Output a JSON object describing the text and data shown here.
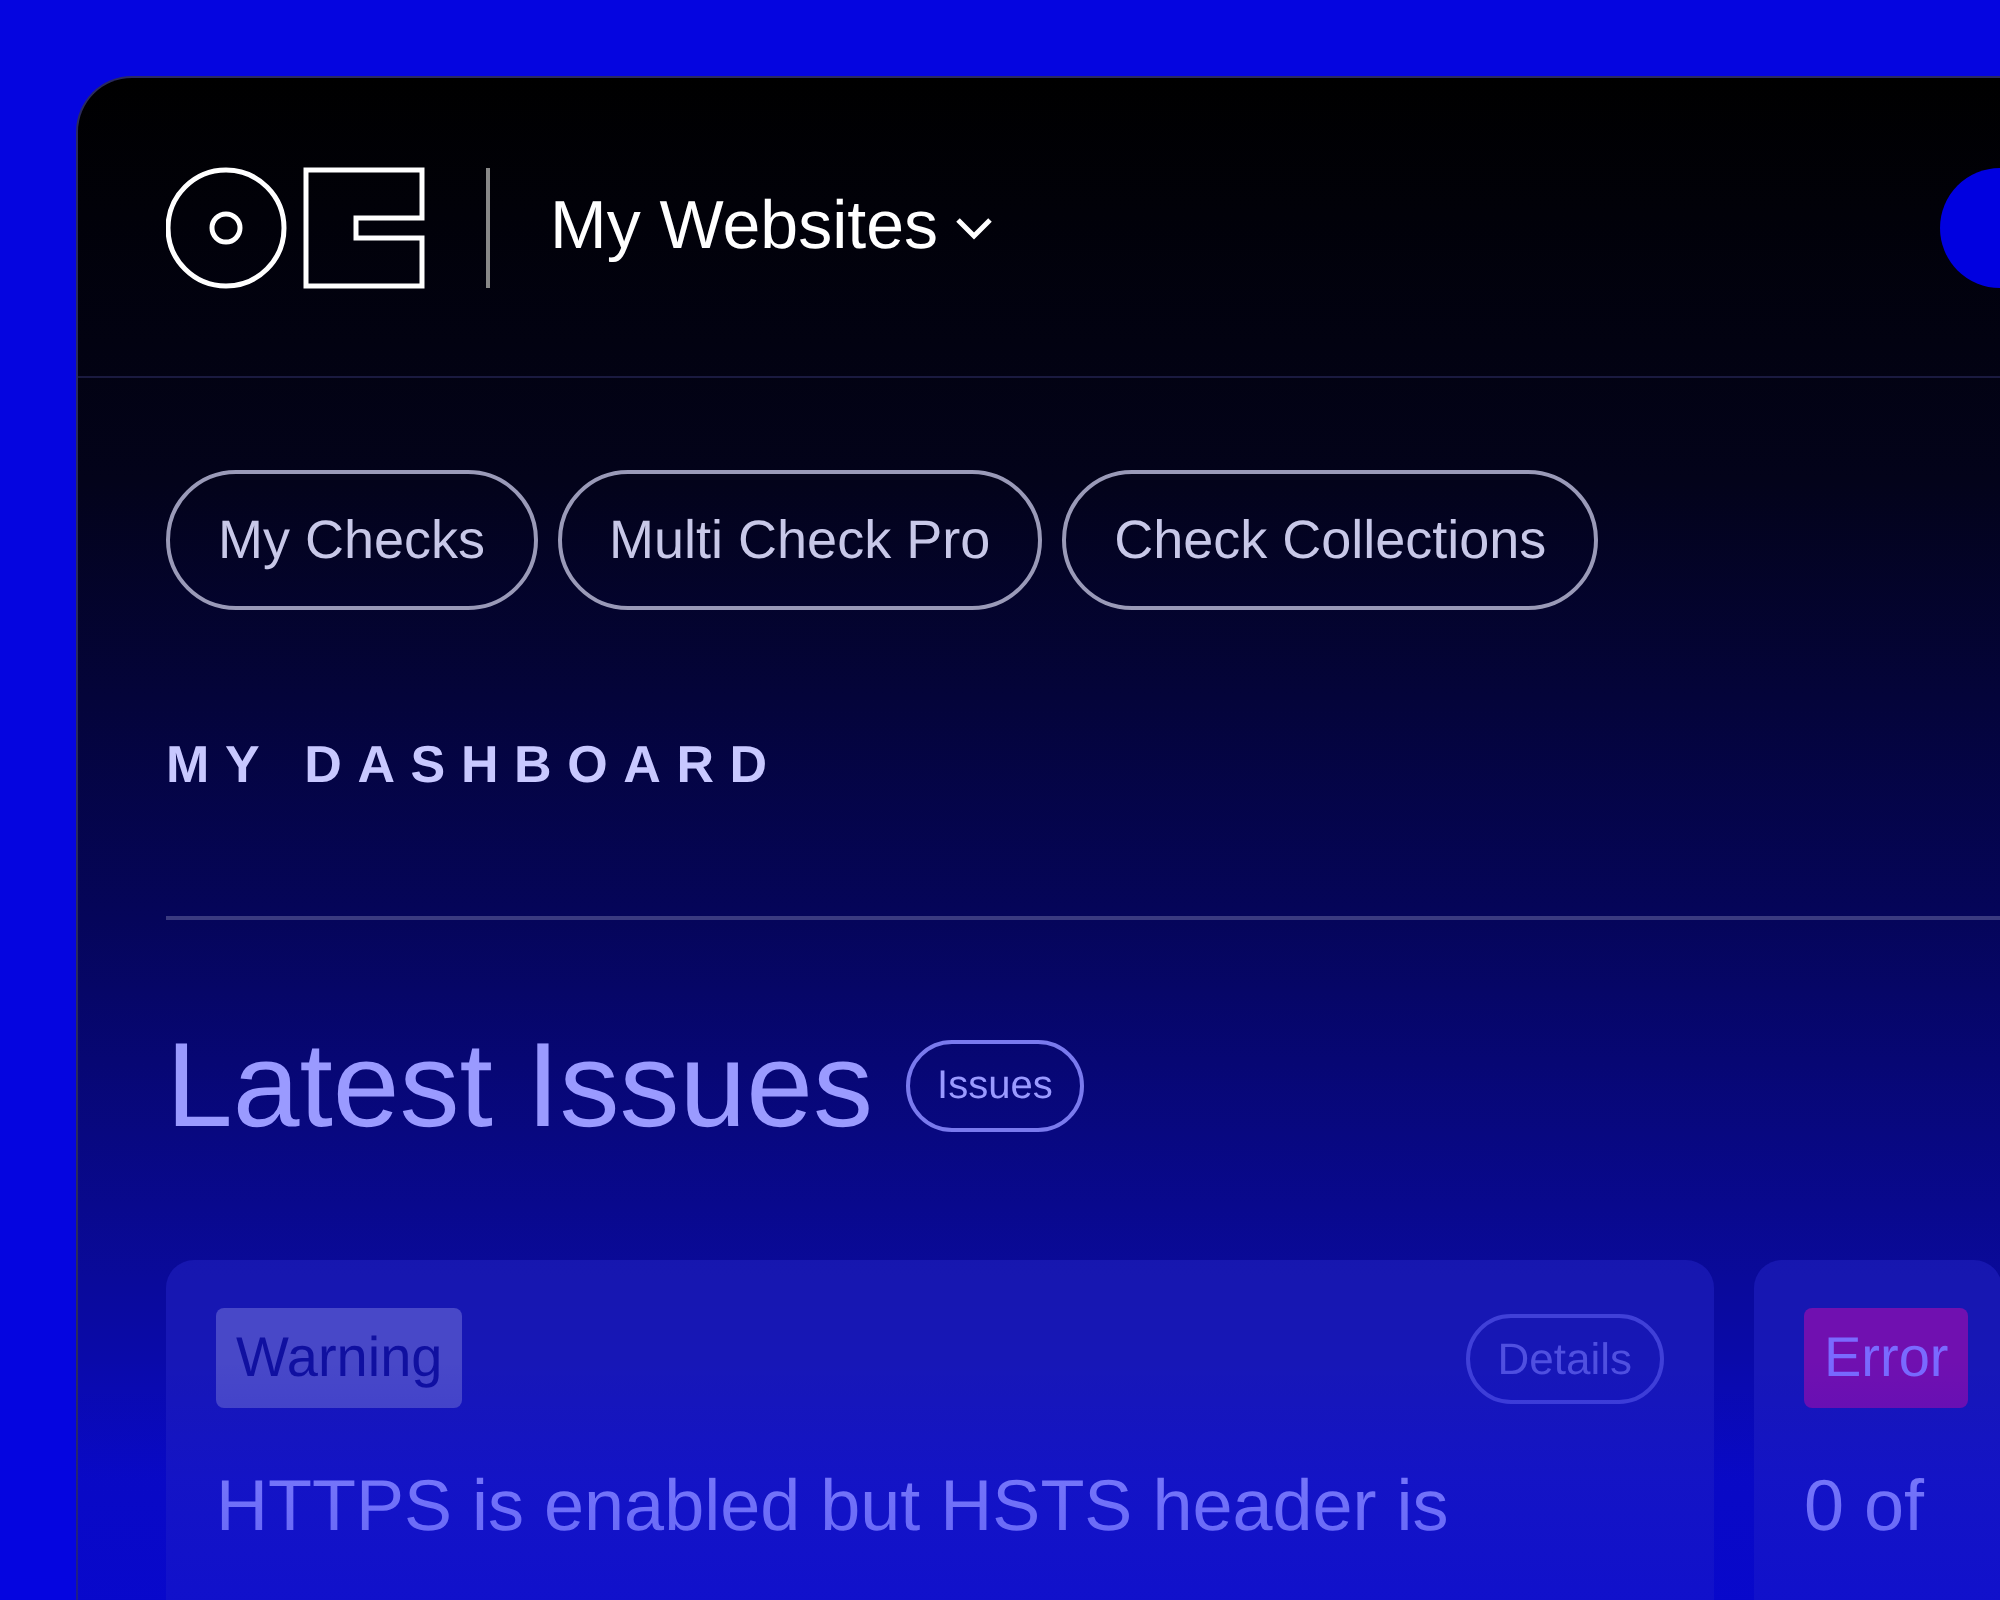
{
  "header": {
    "site_selector": "My Websites"
  },
  "nav_pills": [
    {
      "label": "My Checks"
    },
    {
      "label": "Multi Check Pro"
    },
    {
      "label": "Check Collections"
    }
  ],
  "section_label": "MY DASHBOARD",
  "latest_issues": {
    "title": "Latest Issues",
    "badge": "Issues"
  },
  "issue_cards": [
    {
      "kind": "warning",
      "severity": "Warning",
      "details_button": "Details",
      "message": "HTTPS is enabled but HSTS header is"
    },
    {
      "kind": "error",
      "severity": "Error",
      "message": "0 of"
    }
  ]
}
